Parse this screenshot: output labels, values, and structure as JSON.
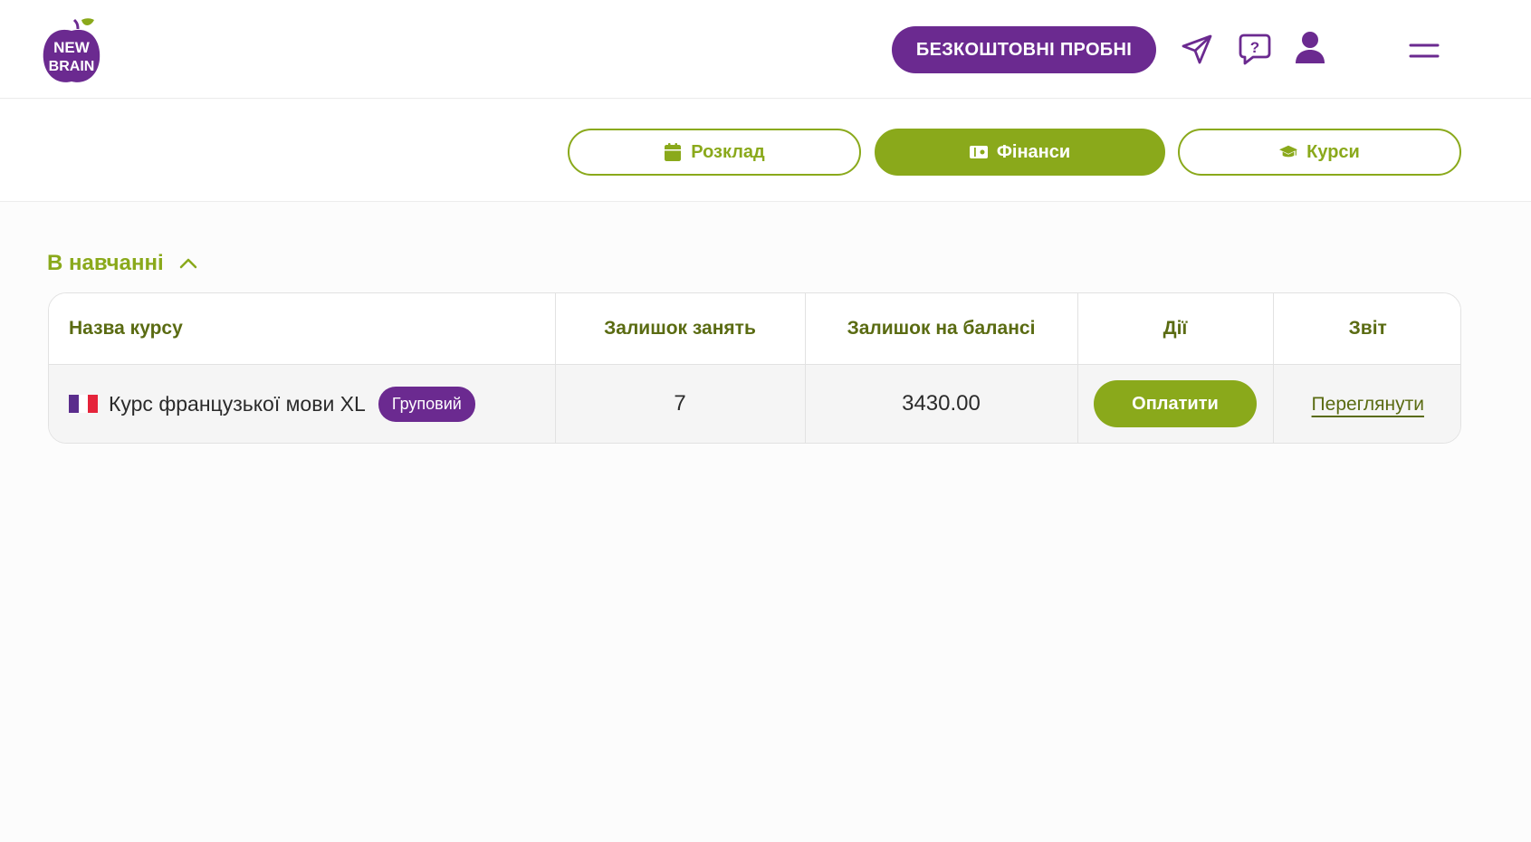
{
  "header": {
    "logo_text": "NEW BRAIN",
    "trial_button": "БЕЗКОШТОВНІ ПРОБНІ",
    "icons": [
      "send-icon",
      "help-chat-icon",
      "user-icon",
      "menu-icon"
    ]
  },
  "tabs": [
    {
      "label": "Розклад",
      "icon": "calendar-icon",
      "active": false
    },
    {
      "label": "Фінанси",
      "icon": "wallet-icon",
      "active": true
    },
    {
      "label": "Курси",
      "icon": "graduation-cap-icon",
      "active": false
    }
  ],
  "section": {
    "title": "В навчанні",
    "expanded": true
  },
  "table": {
    "columns": [
      "Назва курсу",
      "Залишок занять",
      "Залишок на балансі",
      "Дії",
      "Звіт"
    ],
    "rows": [
      {
        "flag": "france-flag",
        "course": "Курс французької мови XL",
        "badge": "Груповий",
        "lessons_left": "7",
        "balance": "3430.00",
        "action": "Оплатити",
        "report": "Переглянути"
      }
    ]
  },
  "colors": {
    "brand_purple": "#6b2a90",
    "brand_green": "#8aa91b",
    "header_text_green": "#5a6b12"
  }
}
